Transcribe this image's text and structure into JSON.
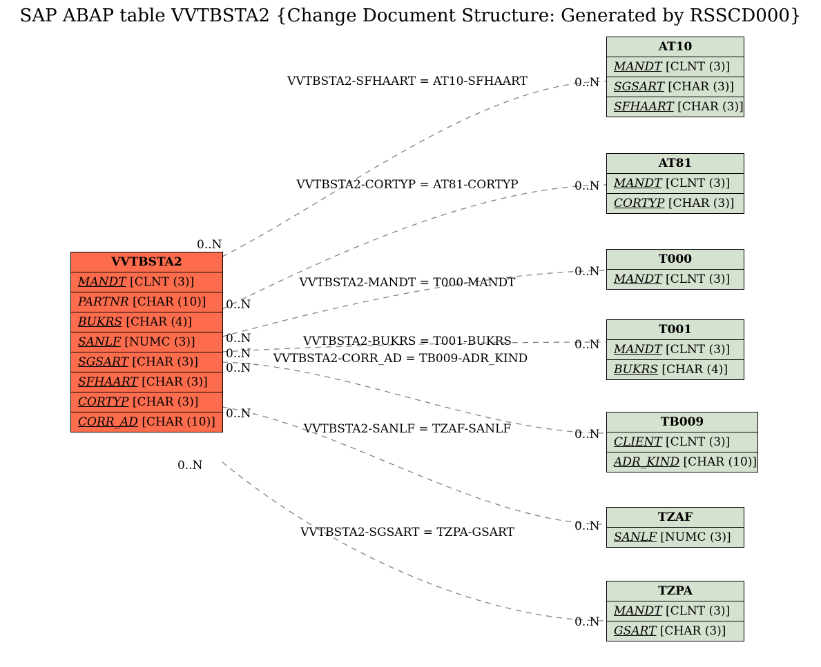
{
  "title": "SAP ABAP table VVTBSTA2 {Change Document Structure: Generated by RSSCD000}",
  "mainEntity": {
    "name": "VVTBSTA2",
    "fields": [
      {
        "name": "MANDT",
        "type": "[CLNT (3)]",
        "key": true
      },
      {
        "name": "PARTNR",
        "type": "[CHAR (10)]",
        "key": false
      },
      {
        "name": "BUKRS",
        "type": "[CHAR (4)]",
        "key": true
      },
      {
        "name": "SANLF",
        "type": "[NUMC (3)]",
        "key": true
      },
      {
        "name": "SGSART",
        "type": "[CHAR (3)]",
        "key": true
      },
      {
        "name": "SFHAART",
        "type": "[CHAR (3)]",
        "key": true
      },
      {
        "name": "CORTYP",
        "type": "[CHAR (3)]",
        "key": true
      },
      {
        "name": "CORR_AD",
        "type": "[CHAR (10)]",
        "key": true
      }
    ]
  },
  "targets": [
    {
      "name": "AT10",
      "fields": [
        {
          "name": "MANDT",
          "type": "[CLNT (3)]",
          "key": true
        },
        {
          "name": "SGSART",
          "type": "[CHAR (3)]",
          "key": true
        },
        {
          "name": "SFHAART",
          "type": "[CHAR (3)]",
          "key": true
        }
      ]
    },
    {
      "name": "AT81",
      "fields": [
        {
          "name": "MANDT",
          "type": "[CLNT (3)]",
          "key": true
        },
        {
          "name": "CORTYP",
          "type": "[CHAR (3)]",
          "key": true
        }
      ]
    },
    {
      "name": "T000",
      "fields": [
        {
          "name": "MANDT",
          "type": "[CLNT (3)]",
          "key": true
        }
      ]
    },
    {
      "name": "T001",
      "fields": [
        {
          "name": "MANDT",
          "type": "[CLNT (3)]",
          "key": true
        },
        {
          "name": "BUKRS",
          "type": "[CHAR (4)]",
          "key": true
        }
      ]
    },
    {
      "name": "TB009",
      "fields": [
        {
          "name": "CLIENT",
          "type": "[CLNT (3)]",
          "key": true
        },
        {
          "name": "ADR_KIND",
          "type": "[CHAR (10)]",
          "key": true
        }
      ]
    },
    {
      "name": "TZAF",
      "fields": [
        {
          "name": "SANLF",
          "type": "[NUMC (3)]",
          "key": true
        }
      ]
    },
    {
      "name": "TZPA",
      "fields": [
        {
          "name": "MANDT",
          "type": "[CLNT (3)]",
          "key": true
        },
        {
          "name": "GSART",
          "type": "[CHAR (3)]",
          "key": true
        }
      ]
    }
  ],
  "relations": [
    {
      "label": "VVTBSTA2-SFHAART = AT10-SFHAART"
    },
    {
      "label": "VVTBSTA2-CORTYP = AT81-CORTYP"
    },
    {
      "label": "VVTBSTA2-MANDT = T000-MANDT"
    },
    {
      "label": "VVTBSTA2-BUKRS = T001-BUKRS"
    },
    {
      "label": "VVTBSTA2-CORR_AD = TB009-ADR_KIND"
    },
    {
      "label": "VVTBSTA2-SANLF = TZAF-SANLF"
    },
    {
      "label": "VVTBSTA2-SGSART = TZPA-GSART"
    }
  ],
  "card": "0..N"
}
